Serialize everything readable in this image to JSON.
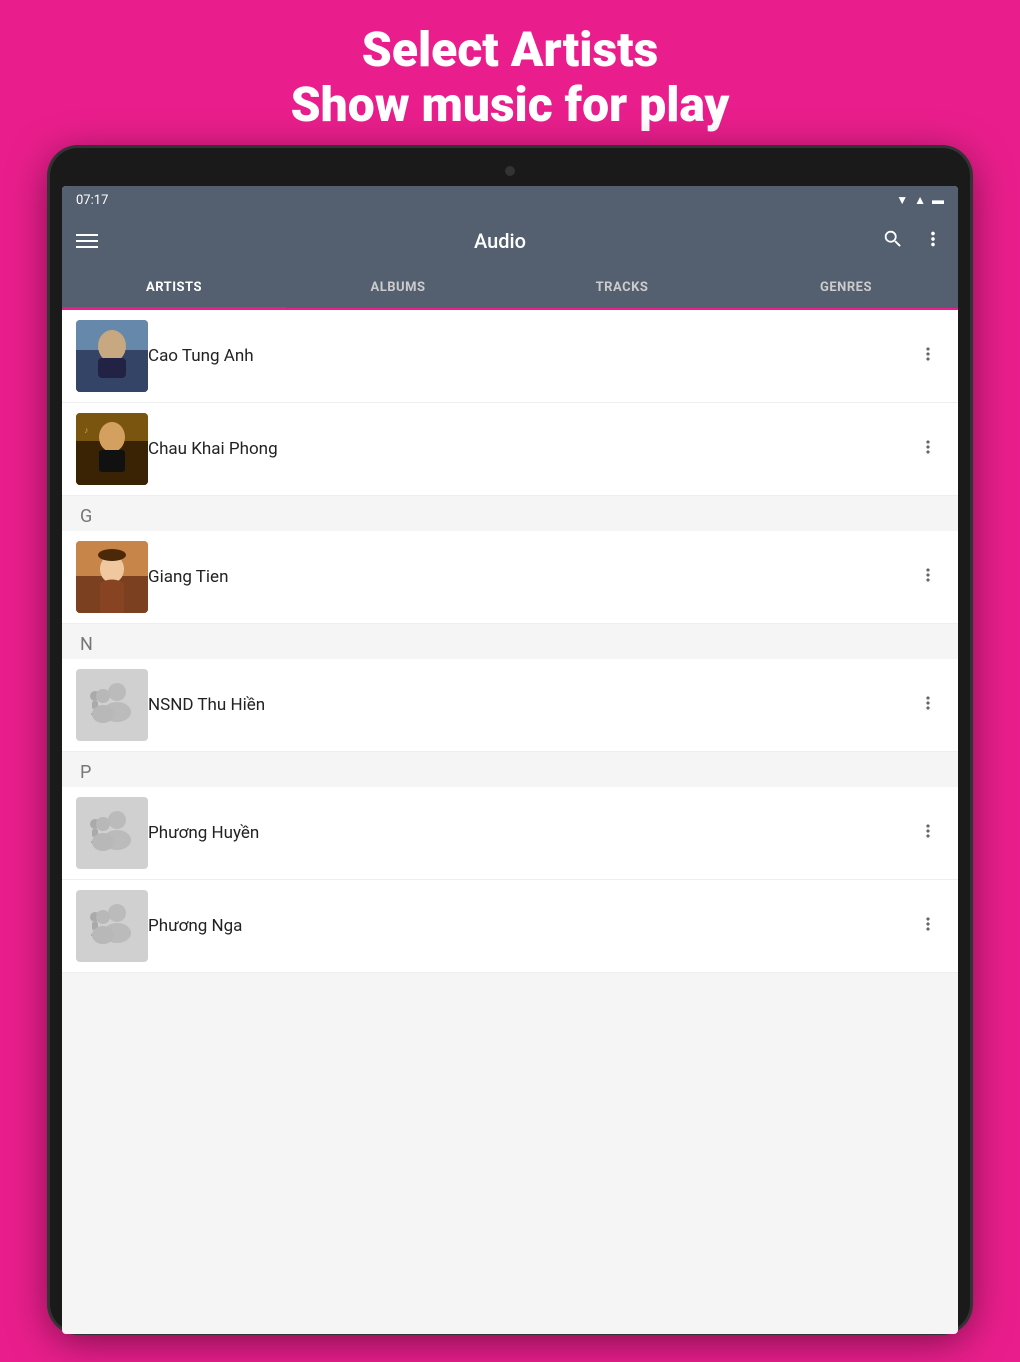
{
  "promo": {
    "line1": "Select Artists",
    "line2": "Show music for play"
  },
  "statusBar": {
    "time": "07:17",
    "icons": [
      "wifi",
      "signal",
      "battery"
    ]
  },
  "appBar": {
    "title": "Audio",
    "searchIcon": "🔍",
    "moreIcon": "⋮"
  },
  "tabs": [
    {
      "id": "artists",
      "label": "ARTISTS",
      "active": true
    },
    {
      "id": "albums",
      "label": "ALBUMS",
      "active": false
    },
    {
      "id": "tracks",
      "label": "TRACKS",
      "active": false
    },
    {
      "id": "genres",
      "label": "GENRES",
      "active": false
    }
  ],
  "sectionHeaders": {
    "G": "G",
    "N": "N",
    "P": "P"
  },
  "artists": [
    {
      "id": 1,
      "name": "Cao Tung Anh",
      "hasPhoto": true,
      "photoType": "cao-tung-anh"
    },
    {
      "id": 2,
      "name": "Chau Khai Phong",
      "hasPhoto": true,
      "photoType": "chau-khai-phong"
    },
    {
      "id": 3,
      "name": "Giang Tien",
      "hasPhoto": true,
      "photoType": "giang-tien",
      "section": "G"
    },
    {
      "id": 4,
      "name": "NSND Thu Hiền",
      "hasPhoto": false,
      "section": "N"
    },
    {
      "id": 5,
      "name": "Phương Huyền",
      "hasPhoto": false,
      "section": "P"
    },
    {
      "id": 6,
      "name": "Phương Nga",
      "hasPhoto": false
    }
  ],
  "moreVertLabel": "⋮"
}
